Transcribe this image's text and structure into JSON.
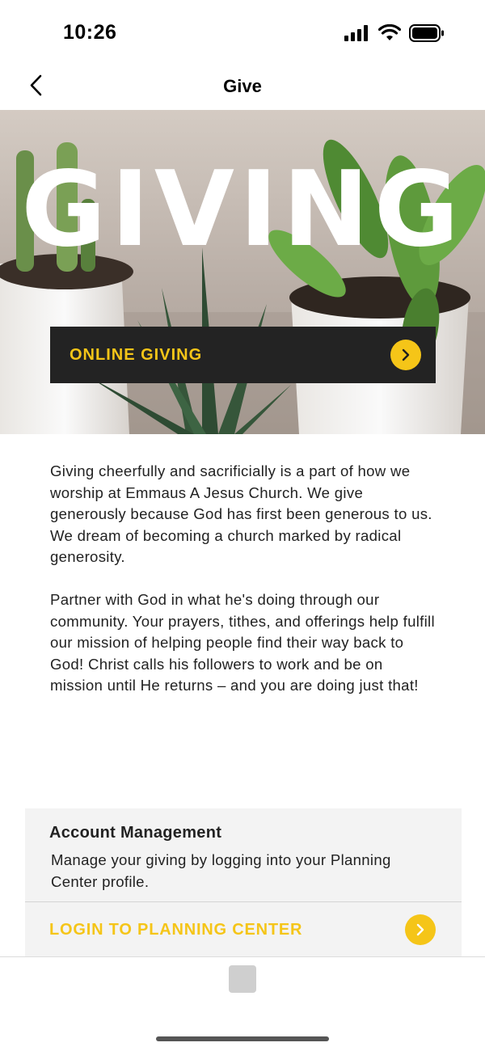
{
  "status_bar": {
    "time": "10:26",
    "icons": [
      "signal-icon",
      "wifi-icon",
      "battery-icon"
    ]
  },
  "nav": {
    "title": "Give",
    "back_icon": "chevron-left-icon"
  },
  "hero": {
    "title": "GIVING",
    "button_label": "ONLINE GIVING",
    "button_icon": "chevron-right-icon"
  },
  "intro": {
    "paragraphs": [
      "Giving cheerfully and sacrificially is a part of how we worship at Emmaus A Jesus Church. We give generously because God has first been generous to us. We dream of becoming a church marked by radical generosity.",
      "Partner with God in what he's doing through our community. Your prayers, tithes, and offerings help fulfill our mission of helping people find their way back to God! Christ calls his followers to work and be on mission until He returns – and you are doing just that!"
    ]
  },
  "account": {
    "title": "Account Management",
    "description": "Manage your giving by logging into your Planning Center profile.",
    "login_label": "LOGIN TO PLANNING CENTER",
    "login_icon": "chevron-right-icon"
  },
  "colors": {
    "accent": "#f5c518",
    "dark_button": "#232323",
    "card_bg": "#f3f3f3"
  }
}
